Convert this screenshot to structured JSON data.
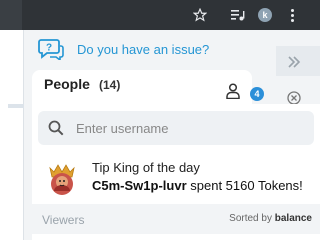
{
  "browser": {
    "profile_initial": "k",
    "icons": [
      "star-icon",
      "media-queue-icon",
      "profile-avatar",
      "kebab-menu-icon"
    ]
  },
  "help": {
    "text": "Do you have an issue?"
  },
  "tabs": {
    "people_label": "People",
    "people_count": "(14)",
    "badge_count": "4"
  },
  "search": {
    "placeholder": "Enter username"
  },
  "tip_king": {
    "title": "Tip King of the day",
    "username": "C5m-Sw1p-luvr",
    "amount_text": " spent 5160 Tokens!"
  },
  "viewers": {
    "label": "Viewers",
    "sorted_prefix": "Sorted by ",
    "sorted_value": "balance"
  },
  "colors": {
    "accent": "#2596d4",
    "badge": "#2b8fd9",
    "chrome_bg": "#2f3337"
  }
}
